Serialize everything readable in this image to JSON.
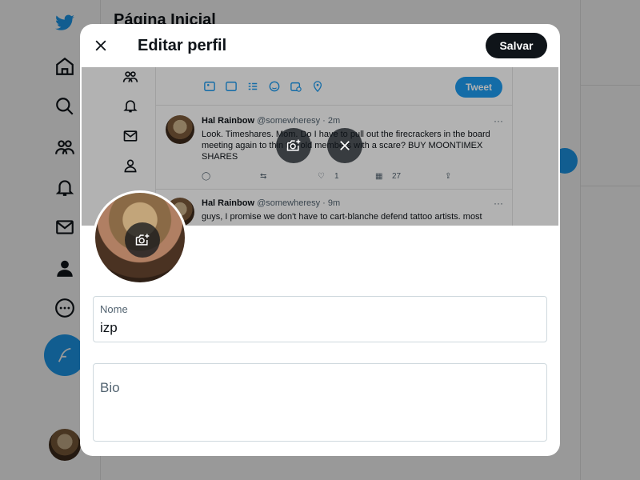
{
  "background": {
    "main_title": "Página Inicial",
    "nav_icons": [
      "twitter-logo",
      "home-icon",
      "search-icon",
      "communities-icon",
      "notifications-icon",
      "messages-icon",
      "profile-icon",
      "more-icon"
    ]
  },
  "modal": {
    "title": "Editar perfil",
    "save_label": "Salvar",
    "banner_preview": {
      "tweet_button": "Tweet",
      "posts": [
        {
          "name": "Hal Rainbow",
          "handle": "@somewheresy",
          "time": "· 2m",
          "text": "Look. Timeshares. Mom. Do I have to pull out the firecrackers in the board meeting again to thin the old members with a scare? BUY MOONTIMEX SHARES",
          "replies": "",
          "retweets": "",
          "likes": "1",
          "views": "27"
        },
        {
          "name": "Hal Rainbow",
          "handle": "@somewheresy",
          "time": "· 9m",
          "text": "guys, I promise we don't have to cart-blanche defend tattoo artists. most"
        }
      ]
    },
    "name_field": {
      "label": "Nome",
      "value": "izp"
    },
    "bio_field": {
      "placeholder": "Bio",
      "value": ""
    }
  },
  "colors": {
    "brand_blue": "#1d9bf0",
    "dark_button": "#0f1419",
    "border": "#cfd9de"
  }
}
